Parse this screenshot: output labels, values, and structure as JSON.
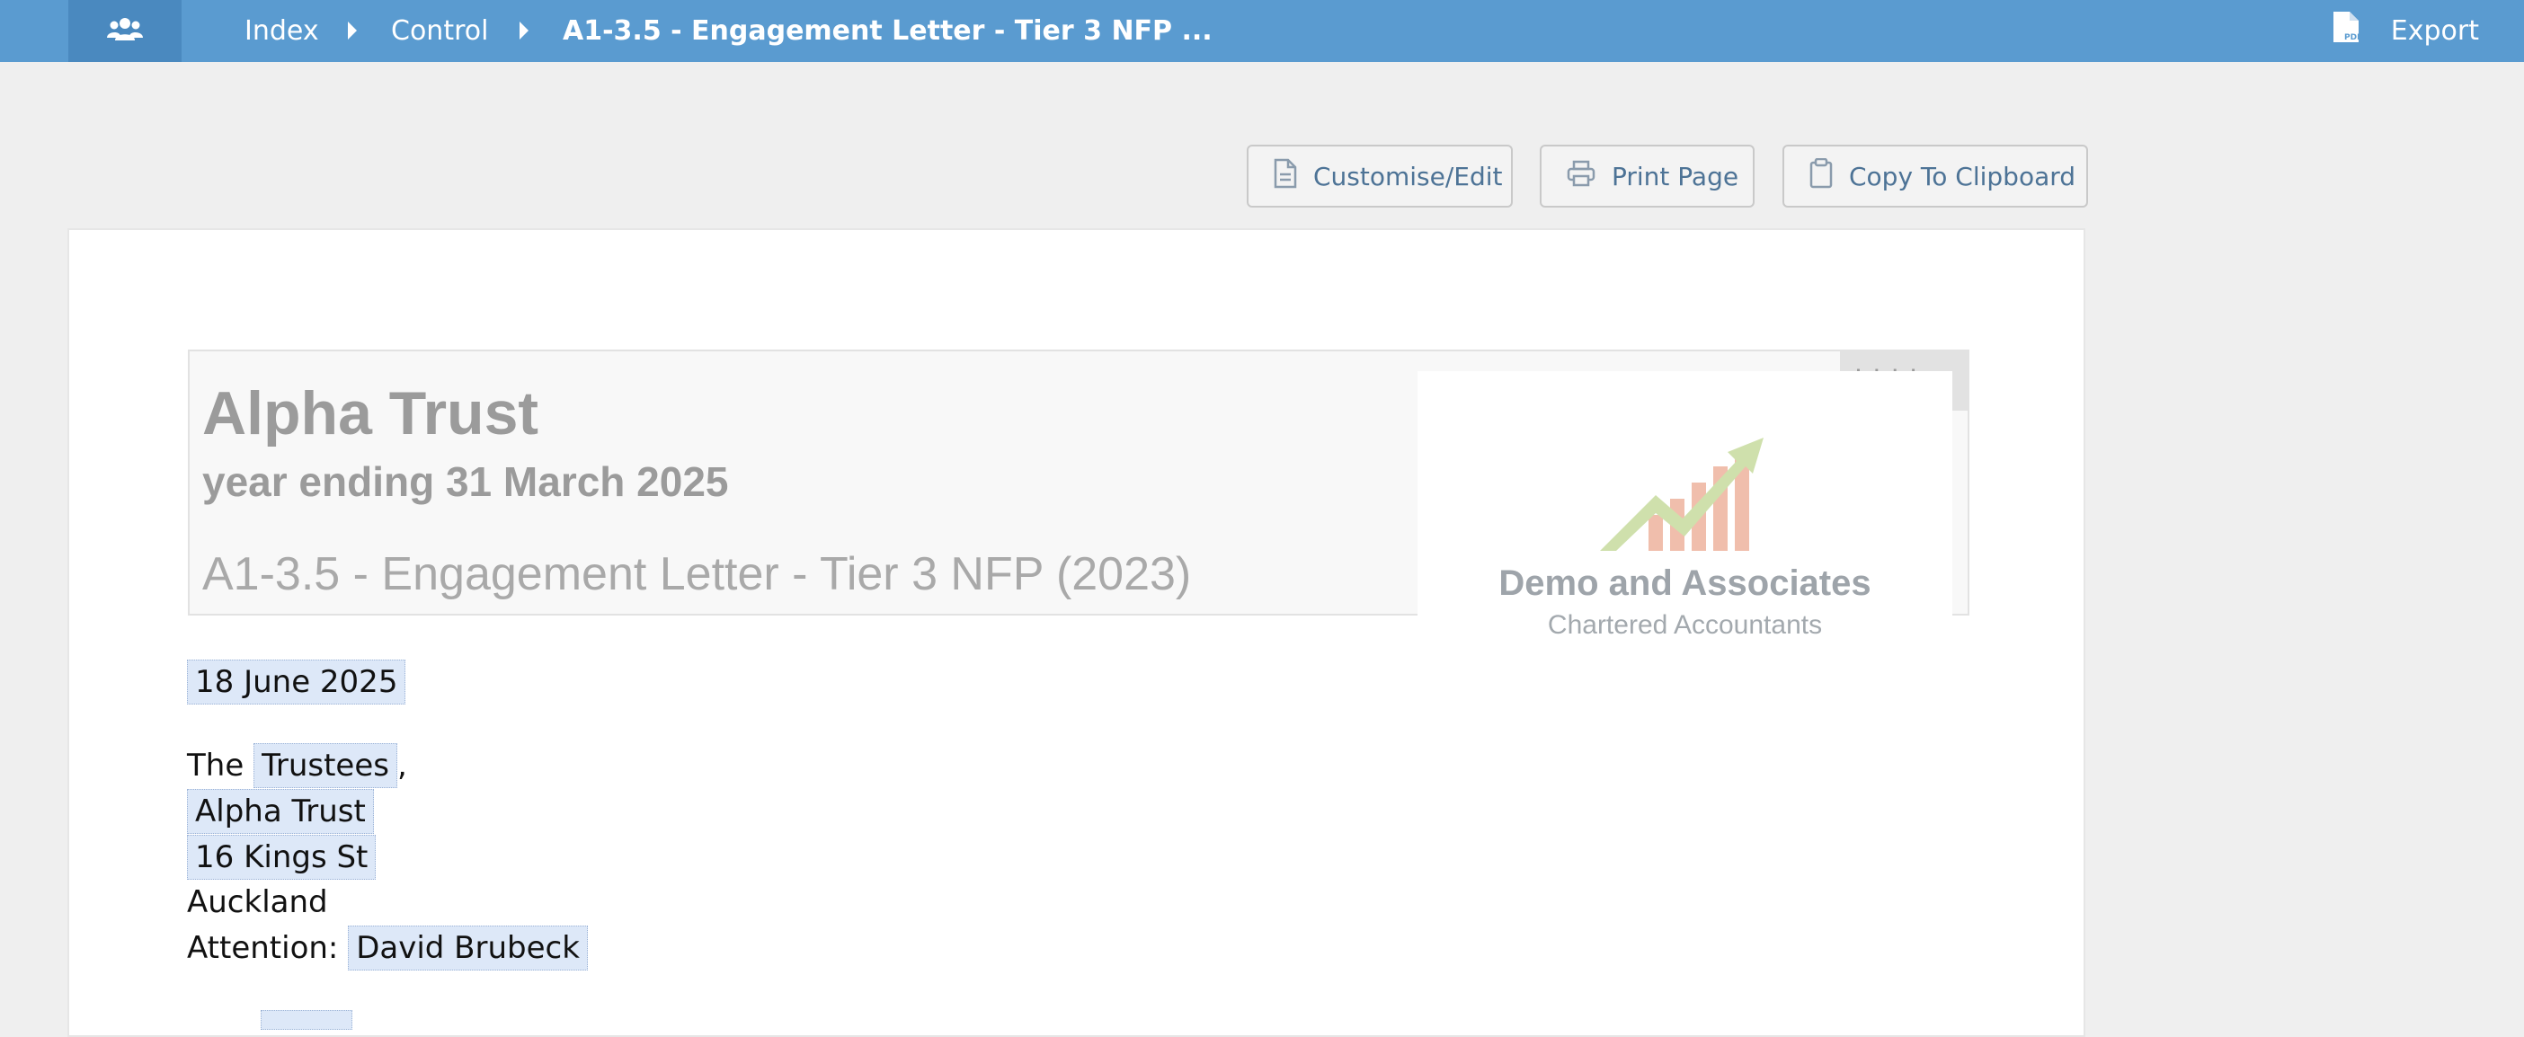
{
  "topbar": {
    "home_icon": "users-icon",
    "breadcrumb": [
      "Index",
      "Control",
      "A1-3.5 - Engagement Letter - Tier 3 NFP ..."
    ],
    "export_icon": "pdf-file-icon",
    "export_label": "Export"
  },
  "toolbar": {
    "customise_label": "Customise/Edit",
    "print_label": "Print Page",
    "copy_label": "Copy To Clipboard"
  },
  "header": {
    "hidden_tag": "hidden",
    "entity_name": "Alpha Trust",
    "period": "year ending 31 March 2025",
    "title": "A1-3.5 - Engagement Letter - Tier 3 NFP (2023)",
    "logo_name": "Demo and Associates",
    "logo_sub": "Chartered Accountants"
  },
  "letter": {
    "date": "18 June 2025",
    "salutation_prefix": "The",
    "addressee_role": "Trustees",
    "salutation_suffix": ",",
    "entity": "Alpha Trust",
    "street": "16 Kings St",
    "city": "Auckland",
    "attention_label": "Attention:",
    "attention_name": "David Brubeck"
  },
  "colors": {
    "topbar": "#5a9bd0",
    "topbar_active": "#4a89bf",
    "field_highlight": "#dde8f8",
    "button_text": "#4d7396"
  }
}
